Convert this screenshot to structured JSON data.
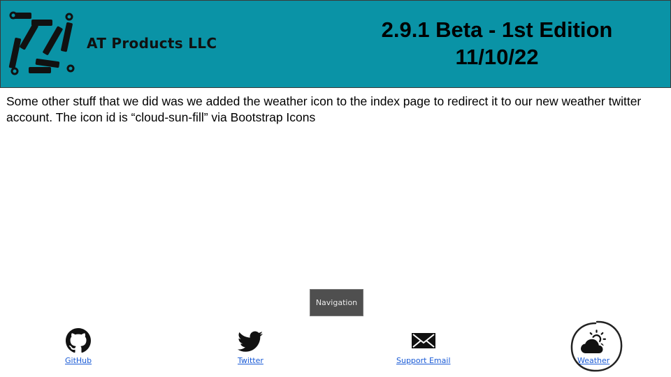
{
  "header": {
    "company_name": "AT Products LLC",
    "title_line1": "2.9.1 Beta - 1st Edition",
    "title_line2": "11/10/22",
    "background_color": "#0a93a6"
  },
  "body": {
    "text": "Some other stuff that we did was we added the weather icon to the index page to redirect it to our new weather twitter account. The icon id is “cloud-sun-fill” via Bootstrap Icons"
  },
  "navigation": {
    "button_label": "Navigation",
    "links": [
      {
        "label": "GitHub",
        "icon": "github-icon"
      },
      {
        "label": "Twitter",
        "icon": "twitter-icon"
      },
      {
        "label": "Support Email",
        "icon": "envelope-icon"
      },
      {
        "label": "Weather",
        "icon": "cloud-sun-fill-icon"
      }
    ]
  },
  "colors": {
    "link": "#1a5bd6",
    "nav_button_bg": "#4f4f4f"
  }
}
